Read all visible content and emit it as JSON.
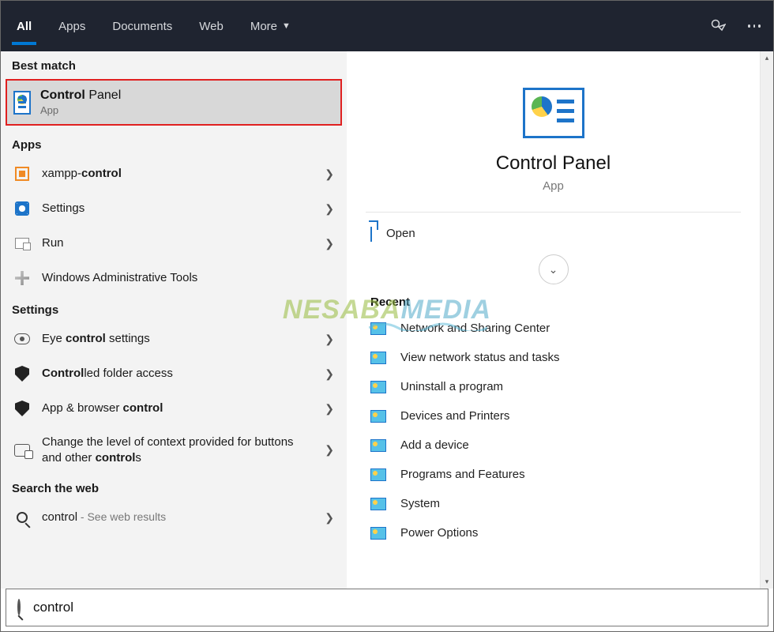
{
  "topbar": {
    "tabs": [
      "All",
      "Apps",
      "Documents",
      "Web",
      "More"
    ]
  },
  "left": {
    "best_match_label": "Best match",
    "best_match": {
      "title_bold": "Control",
      "title_rest": " Panel",
      "subtitle": "App"
    },
    "apps_label": "Apps",
    "apps": [
      {
        "pre": "xampp-",
        "bold": "control",
        "post": ""
      },
      {
        "pre": "",
        "bold": "",
        "post": "Settings"
      },
      {
        "pre": "",
        "bold": "",
        "post": "Run"
      },
      {
        "pre": "",
        "bold": "",
        "post": "Windows Administrative Tools"
      }
    ],
    "settings_label": "Settings",
    "settings": [
      {
        "pre": "Eye ",
        "bold": "control",
        "post": " settings"
      },
      {
        "pre": "",
        "bold": "Control",
        "post": "led folder access"
      },
      {
        "pre": "App & browser ",
        "bold": "control",
        "post": ""
      },
      {
        "pre": "Change the level of context provided for buttons and other ",
        "bold": "control",
        "post": "s"
      }
    ],
    "web_label": "Search the web",
    "web": {
      "query": "control",
      "suffix": " - See web results"
    }
  },
  "right": {
    "hero_title": "Control Panel",
    "hero_sub": "App",
    "open_label": "Open",
    "recent_label": "Recent",
    "recent": [
      "Network and Sharing Center",
      "View network status and tasks",
      "Uninstall a program",
      "Devices and Printers",
      "Add a device",
      "Programs and Features",
      "System",
      "Power Options"
    ]
  },
  "watermark": {
    "part1": "NESABA",
    "part2": "MEDIA"
  },
  "search": {
    "value": "control"
  }
}
